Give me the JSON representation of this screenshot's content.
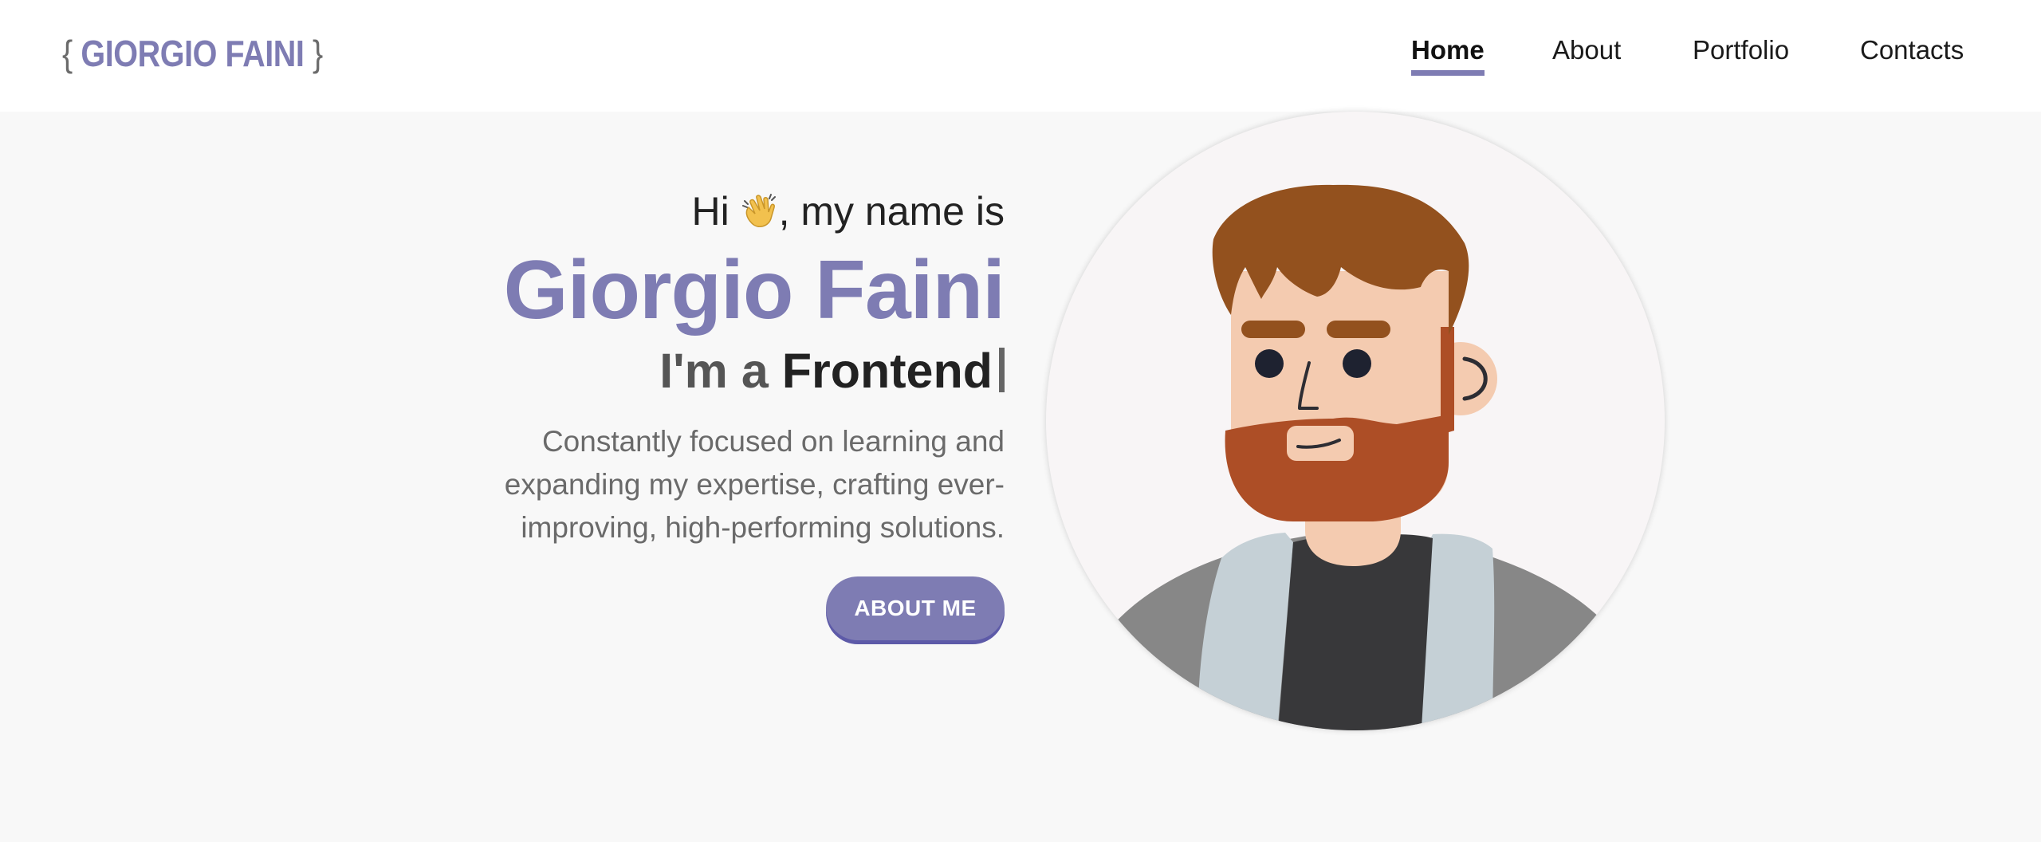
{
  "logo": {
    "open_brace": "{",
    "name": "GIORGIO FAINI",
    "close_brace": "}"
  },
  "nav": {
    "items": [
      {
        "label": "Home",
        "active": true
      },
      {
        "label": "About",
        "active": false
      },
      {
        "label": "Portfolio",
        "active": false
      },
      {
        "label": "Contacts",
        "active": false
      }
    ]
  },
  "hero": {
    "greeting_before": "Hi ",
    "greeting_after": ", my name is",
    "wave_icon": "waving-hand-icon",
    "name": "Giorgio Faini",
    "role_prefix": "I'm a ",
    "role_word": "Frontend",
    "description": "Constantly focused on learning and expanding my expertise, crafting ever-improving, high-performing solutions.",
    "button_label": "ABOUT ME",
    "avatar_icon": "avatar-illustration"
  },
  "colors": {
    "accent": "#7e7cb3",
    "page_background": "#f8f8f8",
    "navbar_background": "#ffffff",
    "text_dark": "#222222",
    "text_muted": "#6a6a6a"
  }
}
